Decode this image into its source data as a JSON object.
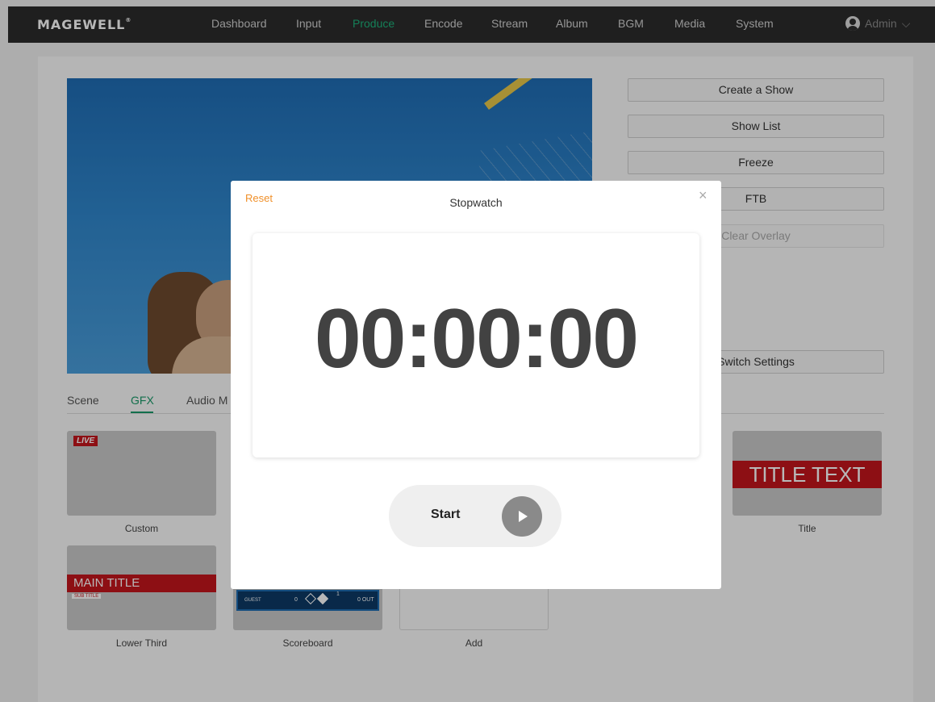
{
  "brand": {
    "logo": "MAGEWELL",
    "mark": "®"
  },
  "nav": {
    "items": [
      {
        "label": "Dashboard"
      },
      {
        "label": "Input"
      },
      {
        "label": "Produce",
        "active": true
      },
      {
        "label": "Encode"
      },
      {
        "label": "Stream"
      },
      {
        "label": "Album"
      },
      {
        "label": "BGM"
      },
      {
        "label": "Media"
      },
      {
        "label": "System"
      }
    ],
    "user": "Admin",
    "user_chevron": "⌵"
  },
  "side_buttons": [
    {
      "label": "Create a Show"
    },
    {
      "label": "Show List"
    },
    {
      "label": "Freeze"
    },
    {
      "label": "FTB"
    },
    {
      "label": "Clear Overlay",
      "disabled": true
    },
    {
      "label": "Switch Settings"
    }
  ],
  "tabs": [
    {
      "label": "Scene"
    },
    {
      "label": "GFX",
      "active": true
    },
    {
      "label": "Audio M"
    }
  ],
  "gfx_cards": {
    "custom": {
      "label": "Custom",
      "badge": "LIVE"
    },
    "title": {
      "label": "Title",
      "text": "TITLE TEXT"
    },
    "lower_third": {
      "label": "Lower Third",
      "main": "MAIN TITLE",
      "sub": "SUB TITLE"
    },
    "scoreboard": {
      "label": "Scoreboard",
      "team": "GUEST",
      "score": "0",
      "inning": "1",
      "outs": "0 OUT"
    },
    "add": {
      "label": "Add"
    }
  },
  "modal": {
    "title": "Stopwatch",
    "reset": "Reset",
    "close": "×",
    "time": "00:00:00",
    "start": "Start"
  },
  "colors": {
    "accent": "#1db27a",
    "reset": "#f0902a",
    "live_red": "#c4161c",
    "nav_bg": "#2b2b2b"
  }
}
